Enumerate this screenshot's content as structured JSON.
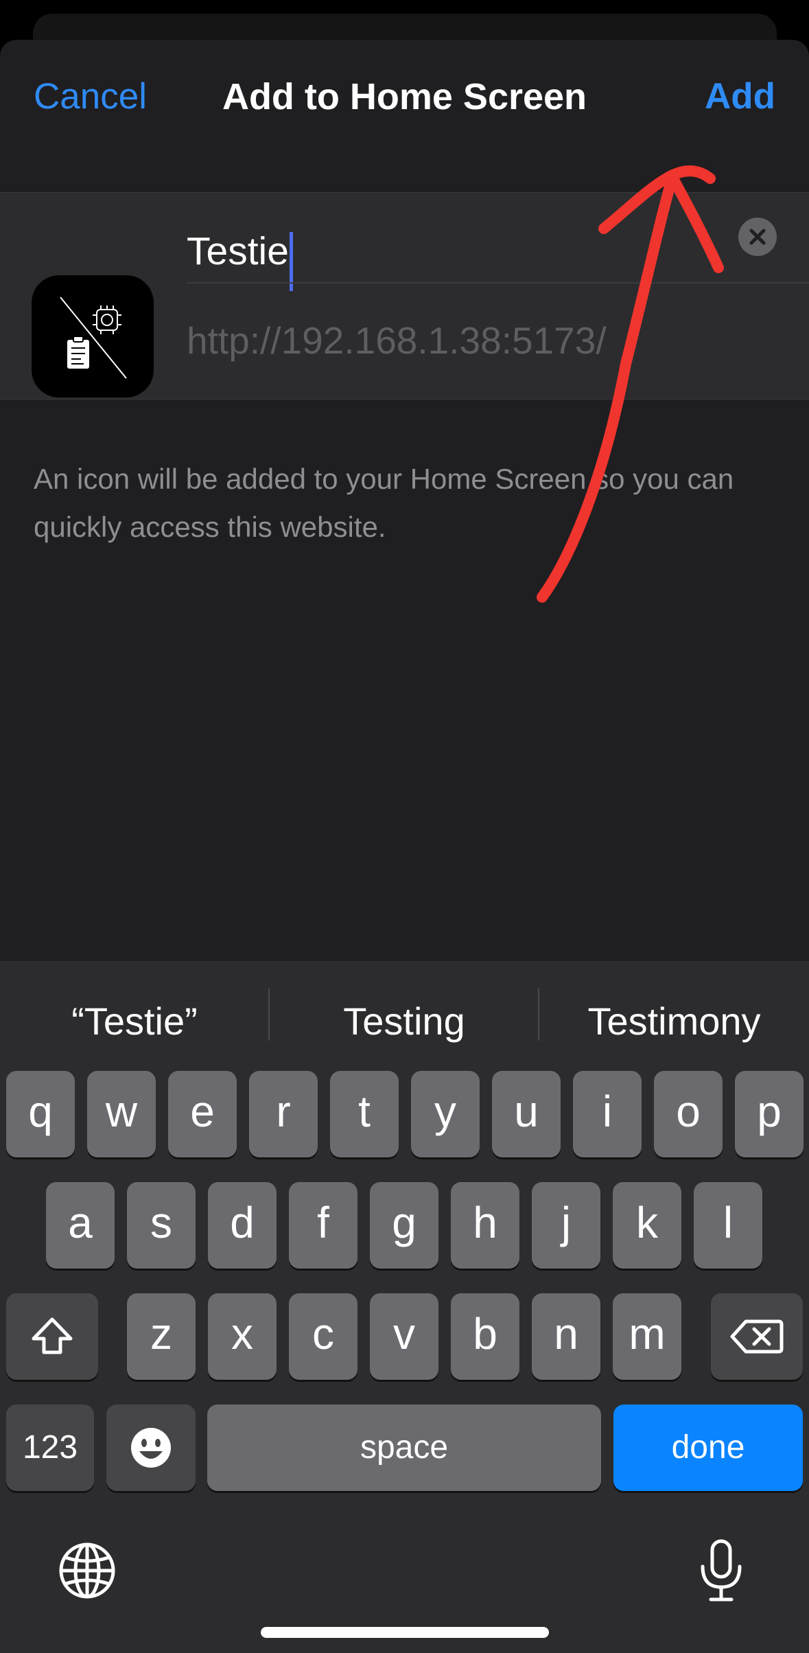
{
  "sheet": {
    "cancel_label": "Cancel",
    "title": "Add to Home Screen",
    "add_label": "Add"
  },
  "bookmark": {
    "name_value": "Testie",
    "url": "http://192.168.1.38:5173/",
    "description": "An icon will be added to your Home Screen so you can quickly access this website."
  },
  "keyboard": {
    "suggestions": [
      "“Testie”",
      "Testing",
      "Testimony"
    ],
    "row1": [
      "q",
      "w",
      "e",
      "r",
      "t",
      "y",
      "u",
      "i",
      "o",
      "p"
    ],
    "row2": [
      "a",
      "s",
      "d",
      "f",
      "g",
      "h",
      "j",
      "k",
      "l"
    ],
    "row3": [
      "z",
      "x",
      "c",
      "v",
      "b",
      "n",
      "m"
    ],
    "numbers_label": "123",
    "space_label": "space",
    "done_label": "done"
  },
  "colors": {
    "accent": "#2f8bf5",
    "annotation": "#f0352e",
    "done_key": "#0a84ff"
  },
  "icons": [
    "app-icon",
    "clear-text-icon",
    "shift-icon",
    "delete-icon",
    "emoji-icon",
    "globe-icon",
    "microphone-icon",
    "arrow-annotation"
  ]
}
